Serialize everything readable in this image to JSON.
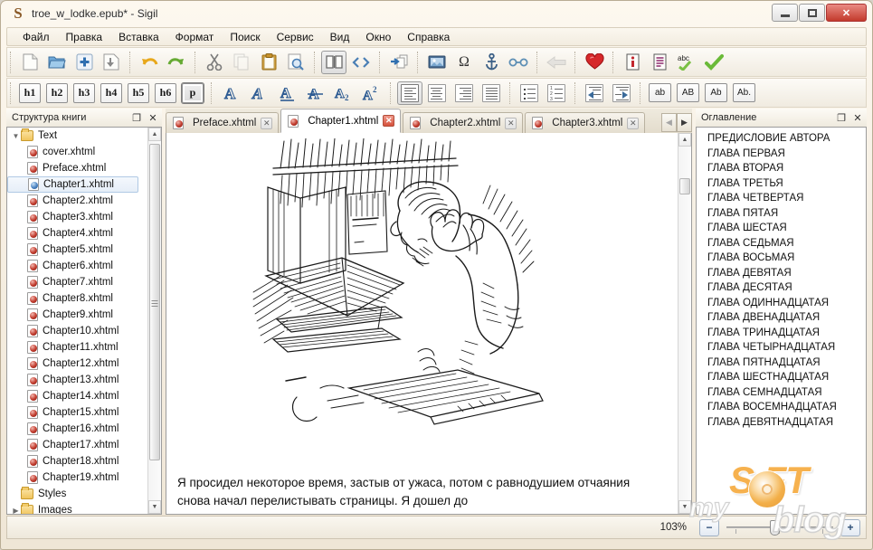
{
  "window": {
    "title": "troe_w_lodke.epub* - Sigil",
    "app_icon": "S",
    "buttons": {
      "minimize": "minimize-icon",
      "maximize": "maximize-icon",
      "close": "✕"
    }
  },
  "menubar": {
    "items": [
      {
        "label": "Файл"
      },
      {
        "label": "Правка"
      },
      {
        "label": "Вставка"
      },
      {
        "label": "Формат"
      },
      {
        "label": "Поиск"
      },
      {
        "label": "Сервис"
      },
      {
        "label": "Вид"
      },
      {
        "label": "Окно"
      },
      {
        "label": "Справка"
      }
    ]
  },
  "toolbar_main": {
    "groups": [
      {
        "buttons": [
          {
            "name": "new-file-icon",
            "glyph": "🗋",
            "state": "enabled"
          },
          {
            "name": "open-folder-icon",
            "glyph": "📂",
            "state": "enabled"
          },
          {
            "name": "add-file-icon",
            "glyph": "✚",
            "state": "enabled"
          },
          {
            "name": "save-icon",
            "glyph": "⤓",
            "state": "enabled"
          }
        ]
      },
      {
        "buttons": [
          {
            "name": "undo-icon",
            "glyph": "↶",
            "state": "enabled"
          },
          {
            "name": "redo-icon",
            "glyph": "↷",
            "state": "enabled"
          }
        ]
      },
      {
        "buttons": [
          {
            "name": "cut-icon",
            "glyph": "✂",
            "state": "enabled"
          },
          {
            "name": "copy-icon",
            "glyph": "⧉",
            "state": "disabled"
          },
          {
            "name": "paste-icon",
            "glyph": "📋",
            "state": "enabled"
          },
          {
            "name": "preview-icon",
            "glyph": "🔍",
            "state": "enabled"
          }
        ]
      },
      {
        "buttons": [
          {
            "name": "book-view-icon",
            "glyph": "📖",
            "state": "pressed"
          },
          {
            "name": "code-view-icon",
            "glyph": "<>",
            "state": "enabled"
          }
        ]
      },
      {
        "buttons": [
          {
            "name": "split-at-cursor-icon",
            "glyph": "⇥",
            "state": "enabled"
          }
        ]
      },
      {
        "buttons": [
          {
            "name": "insert-image-icon",
            "glyph": "🖼",
            "state": "enabled"
          },
          {
            "name": "insert-special-character-icon",
            "glyph": "Ω",
            "state": "enabled"
          },
          {
            "name": "insert-anchor-icon",
            "glyph": "⚓",
            "state": "enabled"
          },
          {
            "name": "insert-link-icon",
            "glyph": "⚯",
            "state": "enabled"
          }
        ]
      },
      {
        "buttons": [
          {
            "name": "back-icon",
            "glyph": "⬅",
            "state": "disabled"
          }
        ]
      },
      {
        "buttons": [
          {
            "name": "add-to-index-heart-icon",
            "glyph": "❤",
            "state": "enabled"
          }
        ]
      },
      {
        "buttons": [
          {
            "name": "metadata-editor-icon",
            "glyph": "ℹ",
            "state": "enabled"
          },
          {
            "name": "generate-toc-icon",
            "glyph": "▤",
            "state": "enabled"
          },
          {
            "name": "spellcheck-icon",
            "glyph": "abc",
            "state": "enabled"
          },
          {
            "name": "validate-icon",
            "glyph": "✔",
            "state": "enabled"
          }
        ]
      }
    ]
  },
  "toolbar_format": {
    "headings": [
      {
        "label": "h1",
        "active": false
      },
      {
        "label": "h2",
        "active": false
      },
      {
        "label": "h3",
        "active": false
      },
      {
        "label": "h4",
        "active": false
      },
      {
        "label": "h5",
        "active": false
      },
      {
        "label": "h6",
        "active": false
      },
      {
        "label": "p",
        "active": true
      }
    ],
    "style_buttons": [
      {
        "name": "bold-icon",
        "glyph": "A"
      },
      {
        "name": "italic-icon",
        "glyph": "A"
      },
      {
        "name": "underline-icon",
        "glyph": "A"
      },
      {
        "name": "strikethrough-icon",
        "glyph": "A"
      },
      {
        "name": "subscript-icon",
        "glyph": "A",
        "affix": "2",
        "affix_pos": "sub"
      },
      {
        "name": "superscript-icon",
        "glyph": "A",
        "affix": "2",
        "affix_pos": "sup"
      }
    ],
    "align_buttons": [
      {
        "name": "align-left-icon",
        "active": true
      },
      {
        "name": "align-center-icon",
        "active": false
      },
      {
        "name": "align-right-icon",
        "active": false
      },
      {
        "name": "align-justify-icon",
        "active": false
      }
    ],
    "list_buttons": [
      {
        "name": "bullet-list-icon",
        "active": false
      },
      {
        "name": "numbered-list-icon",
        "active": false
      }
    ],
    "indent_buttons": [
      {
        "name": "decrease-indent-icon",
        "glyph": "⬅"
      },
      {
        "name": "increase-indent-icon",
        "glyph": "➡"
      }
    ],
    "case_buttons": [
      {
        "label": "ab",
        "name": "lowercase-icon"
      },
      {
        "label": "AB",
        "name": "uppercase-icon"
      },
      {
        "label": "Ab",
        "name": "titlecase-icon"
      },
      {
        "label": "Ab.",
        "name": "capitalize-icon"
      }
    ]
  },
  "left_panel": {
    "title": "Структура книги",
    "header_buttons": [
      {
        "name": "float-panel-icon",
        "glyph": "❐"
      },
      {
        "name": "close-panel-icon",
        "glyph": "✕"
      }
    ],
    "tree": [
      {
        "label": "Text",
        "type": "folder",
        "expanded": true,
        "indent": 1,
        "selected": false
      },
      {
        "label": "cover.xhtml",
        "type": "file",
        "indent": 2,
        "selected": false
      },
      {
        "label": "Preface.xhtml",
        "type": "file",
        "indent": 2,
        "selected": false
      },
      {
        "label": "Chapter1.xhtml",
        "type": "file",
        "indent": 2,
        "selected": true
      },
      {
        "label": "Chapter2.xhtml",
        "type": "file",
        "indent": 2,
        "selected": false
      },
      {
        "label": "Chapter3.xhtml",
        "type": "file",
        "indent": 2,
        "selected": false
      },
      {
        "label": "Chapter4.xhtml",
        "type": "file",
        "indent": 2,
        "selected": false
      },
      {
        "label": "Chapter5.xhtml",
        "type": "file",
        "indent": 2,
        "selected": false
      },
      {
        "label": "Chapter6.xhtml",
        "type": "file",
        "indent": 2,
        "selected": false
      },
      {
        "label": "Chapter7.xhtml",
        "type": "file",
        "indent": 2,
        "selected": false
      },
      {
        "label": "Chapter8.xhtml",
        "type": "file",
        "indent": 2,
        "selected": false
      },
      {
        "label": "Chapter9.xhtml",
        "type": "file",
        "indent": 2,
        "selected": false
      },
      {
        "label": "Chapter10.xhtml",
        "type": "file",
        "indent": 2,
        "selected": false
      },
      {
        "label": "Chapter11.xhtml",
        "type": "file",
        "indent": 2,
        "selected": false
      },
      {
        "label": "Chapter12.xhtml",
        "type": "file",
        "indent": 2,
        "selected": false
      },
      {
        "label": "Chapter13.xhtml",
        "type": "file",
        "indent": 2,
        "selected": false
      },
      {
        "label": "Chapter14.xhtml",
        "type": "file",
        "indent": 2,
        "selected": false
      },
      {
        "label": "Chapter15.xhtml",
        "type": "file",
        "indent": 2,
        "selected": false
      },
      {
        "label": "Chapter16.xhtml",
        "type": "file",
        "indent": 2,
        "selected": false
      },
      {
        "label": "Chapter17.xhtml",
        "type": "file",
        "indent": 2,
        "selected": false
      },
      {
        "label": "Chapter18.xhtml",
        "type": "file",
        "indent": 2,
        "selected": false
      },
      {
        "label": "Chapter19.xhtml",
        "type": "file",
        "indent": 2,
        "selected": false
      },
      {
        "label": "Styles",
        "type": "folder",
        "expanded": false,
        "indent": 1,
        "selected": false
      },
      {
        "label": "Images",
        "type": "folder",
        "expanded": false,
        "collapsible": true,
        "indent": 1,
        "selected": false
      }
    ]
  },
  "right_panel": {
    "title": "Оглавление",
    "header_buttons": [
      {
        "name": "float-panel-icon",
        "glyph": "❐"
      },
      {
        "name": "close-panel-icon",
        "glyph": "✕"
      }
    ],
    "entries": [
      {
        "label": "ПРЕДИСЛОВИЕ АВТОРА"
      },
      {
        "label": "ГЛАВА ПЕРВАЯ"
      },
      {
        "label": "ГЛАВА ВТОРАЯ"
      },
      {
        "label": "ГЛАВА ТРЕТЬЯ"
      },
      {
        "label": "ГЛАВА ЧЕТВЕРТАЯ"
      },
      {
        "label": "ГЛАВА ПЯТАЯ"
      },
      {
        "label": "ГЛАВА ШЕСТАЯ"
      },
      {
        "label": "ГЛАВА СЕДЬМАЯ"
      },
      {
        "label": "ГЛАВА ВОСЬМАЯ"
      },
      {
        "label": "ГЛАВА ДЕВЯТАЯ"
      },
      {
        "label": "ГЛАВА ДЕСЯТАЯ"
      },
      {
        "label": "ГЛАВА ОДИННАДЦАТАЯ"
      },
      {
        "label": "ГЛАВА ДВЕНАДЦАТАЯ"
      },
      {
        "label": "ГЛАВА ТРИНАДЦАТАЯ"
      },
      {
        "label": "ГЛАВА ЧЕТЫРНАДЦАТАЯ"
      },
      {
        "label": "ГЛАВА ПЯТНАДЦАТАЯ"
      },
      {
        "label": "ГЛАВА ШЕСТНАДЦАТАЯ"
      },
      {
        "label": "ГЛАВА СЕМНАДЦАТАЯ"
      },
      {
        "label": "ГЛАВА ВОСЕМНАДЦАТАЯ"
      },
      {
        "label": "ГЛАВА ДЕВЯТНАДЦАТАЯ"
      }
    ]
  },
  "tabs": {
    "items": [
      {
        "label": "Preface.xhtml",
        "active": false,
        "close": "✕"
      },
      {
        "label": "Chapter1.xhtml",
        "active": true,
        "close": "✕"
      },
      {
        "label": "Chapter2.xhtml",
        "active": false,
        "close": "✕"
      },
      {
        "label": "Chapter3.xhtml",
        "active": false,
        "close": "✕"
      }
    ],
    "nav": [
      {
        "name": "tab-scroll-left-icon",
        "glyph": "◀"
      },
      {
        "name": "tab-scroll-right-icon",
        "glyph": "▶"
      }
    ]
  },
  "editor": {
    "illustration_alt": "Man reading books with head in hand, line engraving",
    "paragraph": "Я просидел некоторое время, застыв от ужаса, потом с равнодушием отчаяния снова начал перелистывать страницы. Я дошел до"
  },
  "statusbar": {
    "zoom_label": "103%",
    "zoom_out": "−",
    "zoom_in": "+"
  },
  "watermark": {
    "part1": "my",
    "part2": "S  FT",
    "part3": "blog"
  },
  "colors": {
    "accent": "#2c5a92",
    "close_red": "#c33a2c",
    "watermark_orange": "#f6ab3f",
    "folder_yellow": "#f0c45c",
    "selection_blue": "#b0c9e4"
  }
}
